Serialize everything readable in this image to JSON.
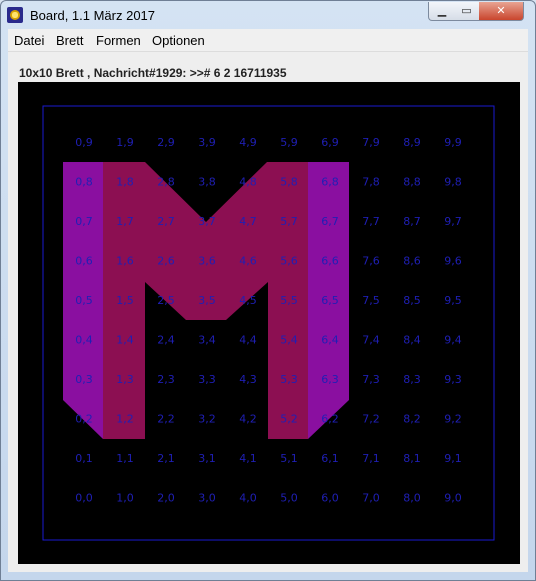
{
  "window": {
    "title": "Board, 1.1 März 2017",
    "controls": {
      "minimize": "▁",
      "maximize": "▭",
      "close": "✕"
    }
  },
  "menu": [
    "Datei",
    "Brett",
    "Formen",
    "Optionen"
  ],
  "status": "10x10 Brett , Nachricht#1929: >># 6 2 16711935",
  "board": {
    "size": 10,
    "colors": {
      "background": "#000000",
      "border": "#1a1ad0",
      "label": "#1f1fb5",
      "letter_outer": "#8a0fa0",
      "letter_inner": "#8c0f52"
    },
    "labels": [
      [
        "0,9",
        "1,9",
        "2,9",
        "3,9",
        "4,9",
        "5,9",
        "6,9",
        "7,9",
        "8,9",
        "9,9"
      ],
      [
        "0,8",
        "1,8",
        "2,8",
        "3,8",
        "4,8",
        "5,8",
        "6,8",
        "7,8",
        "8,8",
        "9,8"
      ],
      [
        "0,7",
        "1,7",
        "2,7",
        "3,7",
        "4,7",
        "5,7",
        "6,7",
        "7,7",
        "8,7",
        "9,7"
      ],
      [
        "0,6",
        "1,6",
        "2,6",
        "3,6",
        "4,6",
        "5,6",
        "6,6",
        "7,6",
        "8,6",
        "9,6"
      ],
      [
        "0,5",
        "1,5",
        "2,5",
        "3,5",
        "4,5",
        "5,5",
        "6,5",
        "7,5",
        "8,5",
        "9,5"
      ],
      [
        "0,4",
        "1,4",
        "2,4",
        "3,4",
        "4,4",
        "5,4",
        "6,4",
        "7,4",
        "8,4",
        "9,4"
      ],
      [
        "0,3",
        "1,3",
        "2,3",
        "3,3",
        "4,3",
        "5,3",
        "6,3",
        "7,3",
        "8,3",
        "9,3"
      ],
      [
        "0,2",
        "1,2",
        "2,2",
        "3,2",
        "4,2",
        "5,2",
        "6,2",
        "7,2",
        "8,2",
        "9,2"
      ],
      [
        "0,1",
        "1,1",
        "2,1",
        "3,1",
        "4,1",
        "5,1",
        "6,1",
        "7,1",
        "8,1",
        "9,1"
      ],
      [
        "0,0",
        "1,0",
        "2,0",
        "3,0",
        "4,0",
        "5,0",
        "6,0",
        "7,0",
        "8,0",
        "9,0"
      ]
    ]
  }
}
